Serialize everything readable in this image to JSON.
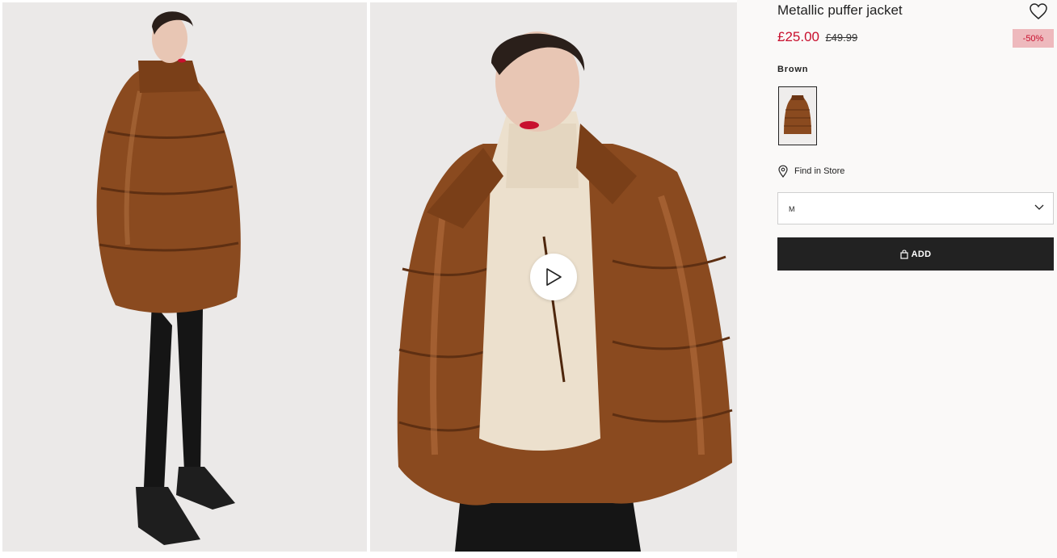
{
  "product": {
    "title": "Metallic puffer jacket",
    "price_sale": "£25.00",
    "price_original": "£49.99",
    "discount": "-50%",
    "color_label": "Brown",
    "find_in_store": "Find in Store",
    "size_selected": "M",
    "add_label": "ADD"
  },
  "icons": {
    "favorite": "heart-icon",
    "play": "play-icon",
    "location": "location-pin-icon",
    "dropdown": "chevron-down-icon",
    "bag": "shopping-bag-icon"
  },
  "colors": {
    "sale": "#c8102e",
    "discount_bg": "#eeb9bd",
    "button_bg": "#222222",
    "jacket": "#8a4a1f"
  }
}
